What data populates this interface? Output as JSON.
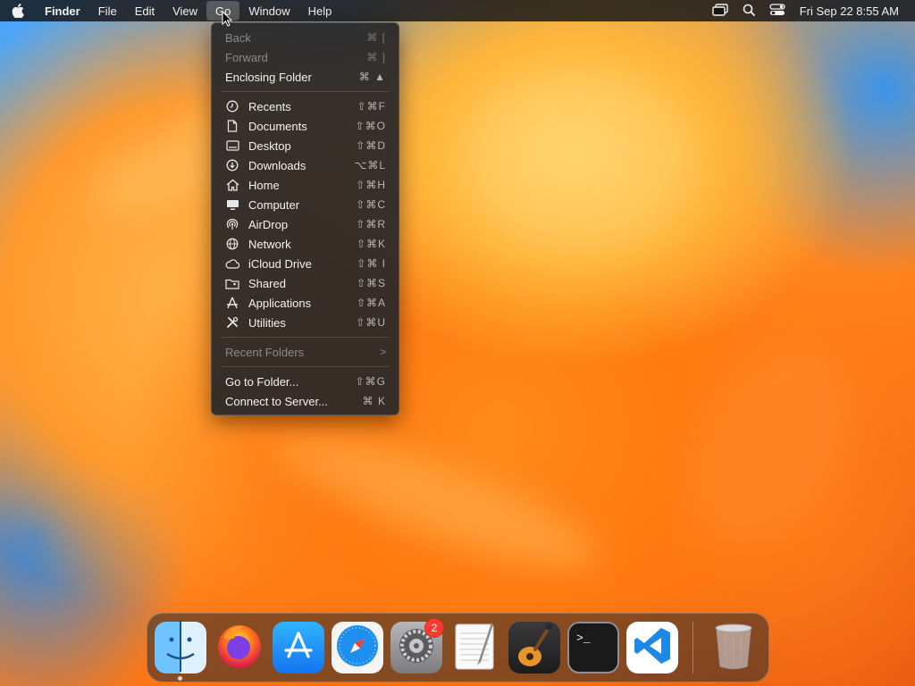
{
  "menubar": {
    "apple_icon": "apple-logo-icon",
    "menus": [
      {
        "label": "Finder"
      },
      {
        "label": "File"
      },
      {
        "label": "Edit"
      },
      {
        "label": "View"
      },
      {
        "label": "Go"
      },
      {
        "label": "Window"
      },
      {
        "label": "Help"
      }
    ],
    "status_icons": [
      "screen-mirroring-icon",
      "spotlight-search-icon",
      "control-center-icon"
    ],
    "clock": "Fri Sep 22  8:55 AM"
  },
  "go_menu": {
    "items": [
      {
        "label": "Back",
        "shortcut": "⌘ [",
        "disabled": true
      },
      {
        "label": "Forward",
        "shortcut": "⌘ ]",
        "disabled": true
      },
      {
        "label": "Enclosing Folder",
        "shortcut": "⌘ ▲"
      },
      {
        "label": "Recents",
        "shortcut": "⇧⌘F",
        "icon": "clock-icon"
      },
      {
        "label": "Documents",
        "shortcut": "⇧⌘O",
        "icon": "document-icon"
      },
      {
        "label": "Desktop",
        "shortcut": "⇧⌘D",
        "icon": "desktop-icon"
      },
      {
        "label": "Downloads",
        "shortcut": "⌥⌘L",
        "icon": "download-icon"
      },
      {
        "label": "Home",
        "shortcut": "⇧⌘H",
        "icon": "house-icon"
      },
      {
        "label": "Computer",
        "shortcut": "⇧⌘C",
        "icon": "computer-icon"
      },
      {
        "label": "AirDrop",
        "shortcut": "⇧⌘R",
        "icon": "airdrop-icon"
      },
      {
        "label": "Network",
        "shortcut": "⇧⌘K",
        "icon": "globe-icon"
      },
      {
        "label": "iCloud Drive",
        "shortcut": "⇧⌘ I",
        "icon": "cloud-icon"
      },
      {
        "label": "Shared",
        "shortcut": "⇧⌘S",
        "icon": "shared-folder-icon"
      },
      {
        "label": "Applications",
        "shortcut": "⇧⌘A",
        "icon": "applications-icon"
      },
      {
        "label": "Utilities",
        "shortcut": "⇧⌘U",
        "icon": "tools-icon"
      },
      {
        "label": "Recent Folders",
        "shortcut": ">",
        "disabled": true
      },
      {
        "label": "Go to Folder...",
        "shortcut": "⇧⌘G"
      },
      {
        "label": "Connect to Server...",
        "shortcut": "⌘ K"
      }
    ]
  },
  "dock": {
    "apps": [
      {
        "name": "Finder",
        "icon": "finder-icon",
        "running": true
      },
      {
        "name": "Firefox",
        "icon": "firefox-icon"
      },
      {
        "name": "App Store",
        "icon": "app-store-icon"
      },
      {
        "name": "Safari",
        "icon": "safari-icon"
      },
      {
        "name": "System Settings",
        "icon": "system-settings-icon",
        "badge": "2"
      },
      {
        "name": "TextEdit",
        "icon": "textedit-icon"
      },
      {
        "name": "GarageBand",
        "icon": "garageband-icon"
      },
      {
        "name": "Terminal",
        "icon": "terminal-icon"
      },
      {
        "name": "Visual Studio Code",
        "icon": "vscode-icon"
      },
      {
        "name": "Trash",
        "icon": "trash-icon"
      }
    ]
  },
  "colors": {
    "menu_bg": "#262628",
    "menu_text": "#f2f2f2",
    "disabled_text": "#8a8a8d",
    "badge": "#ff3b30"
  }
}
